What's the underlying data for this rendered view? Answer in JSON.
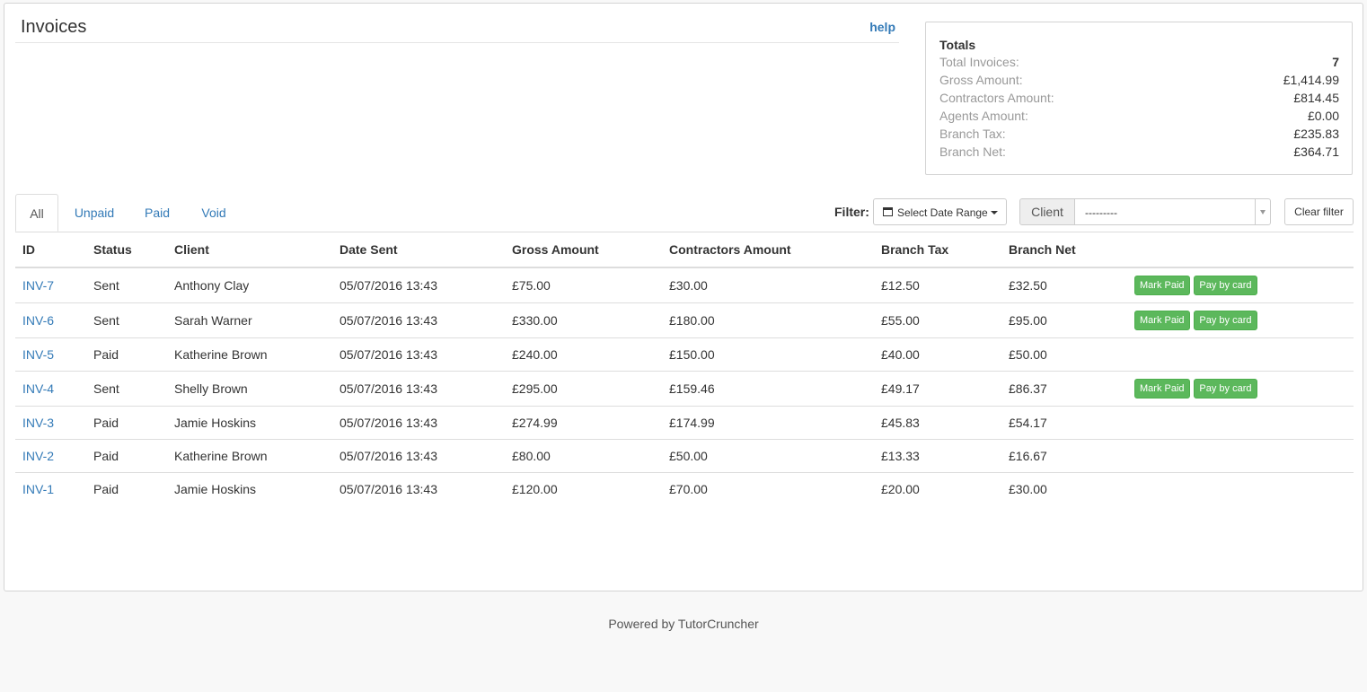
{
  "header": {
    "title": "Invoices",
    "help_label": "help"
  },
  "totals": {
    "title": "Totals",
    "rows": [
      {
        "label": "Total Invoices:",
        "value": "7"
      },
      {
        "label": "Gross Amount:",
        "value": "£1,414.99"
      },
      {
        "label": "Contractors Amount:",
        "value": "£814.45"
      },
      {
        "label": "Agents Amount:",
        "value": "£0.00"
      },
      {
        "label": "Branch Tax:",
        "value": "£235.83"
      },
      {
        "label": "Branch Net:",
        "value": "£364.71"
      }
    ]
  },
  "tabs": [
    {
      "label": "All",
      "active": true
    },
    {
      "label": "Unpaid",
      "active": false
    },
    {
      "label": "Paid",
      "active": false
    },
    {
      "label": "Void",
      "active": false
    }
  ],
  "filter": {
    "label": "Filter:",
    "date_range_label": "Select Date Range",
    "client_label": "Client",
    "client_value": "---------",
    "clear_label": "Clear filter"
  },
  "table": {
    "columns": [
      "ID",
      "Status",
      "Client",
      "Date Sent",
      "Gross Amount",
      "Contractors Amount",
      "Branch Tax",
      "Branch Net"
    ],
    "rows": [
      {
        "id": "INV-7",
        "status": "Sent",
        "client": "Anthony Clay",
        "date_sent": "05/07/2016 13:43",
        "gross": "£75.00",
        "contractors": "£30.00",
        "branch_tax": "£12.50",
        "branch_net": "£32.50",
        "actions": [
          "Mark Paid",
          "Pay by card"
        ]
      },
      {
        "id": "INV-6",
        "status": "Sent",
        "client": "Sarah Warner",
        "date_sent": "05/07/2016 13:43",
        "gross": "£330.00",
        "contractors": "£180.00",
        "branch_tax": "£55.00",
        "branch_net": "£95.00",
        "actions": [
          "Mark Paid",
          "Pay by card"
        ]
      },
      {
        "id": "INV-5",
        "status": "Paid",
        "client": "Katherine Brown",
        "date_sent": "05/07/2016 13:43",
        "gross": "£240.00",
        "contractors": "£150.00",
        "branch_tax": "£40.00",
        "branch_net": "£50.00",
        "actions": []
      },
      {
        "id": "INV-4",
        "status": "Sent",
        "client": "Shelly Brown",
        "date_sent": "05/07/2016 13:43",
        "gross": "£295.00",
        "contractors": "£159.46",
        "branch_tax": "£49.17",
        "branch_net": "£86.37",
        "actions": [
          "Mark Paid",
          "Pay by card"
        ]
      },
      {
        "id": "INV-3",
        "status": "Paid",
        "client": "Jamie Hoskins",
        "date_sent": "05/07/2016 13:43",
        "gross": "£274.99",
        "contractors": "£174.99",
        "branch_tax": "£45.83",
        "branch_net": "£54.17",
        "actions": []
      },
      {
        "id": "INV-2",
        "status": "Paid",
        "client": "Katherine Brown",
        "date_sent": "05/07/2016 13:43",
        "gross": "£80.00",
        "contractors": "£50.00",
        "branch_tax": "£13.33",
        "branch_net": "£16.67",
        "actions": []
      },
      {
        "id": "INV-1",
        "status": "Paid",
        "client": "Jamie Hoskins",
        "date_sent": "05/07/2016 13:43",
        "gross": "£120.00",
        "contractors": "£70.00",
        "branch_tax": "£20.00",
        "branch_net": "£30.00",
        "actions": []
      }
    ]
  },
  "footer": {
    "text": "Powered by TutorCruncher"
  },
  "colors": {
    "link": "#337ab7",
    "success": "#5cb85c",
    "muted": "#999999"
  }
}
